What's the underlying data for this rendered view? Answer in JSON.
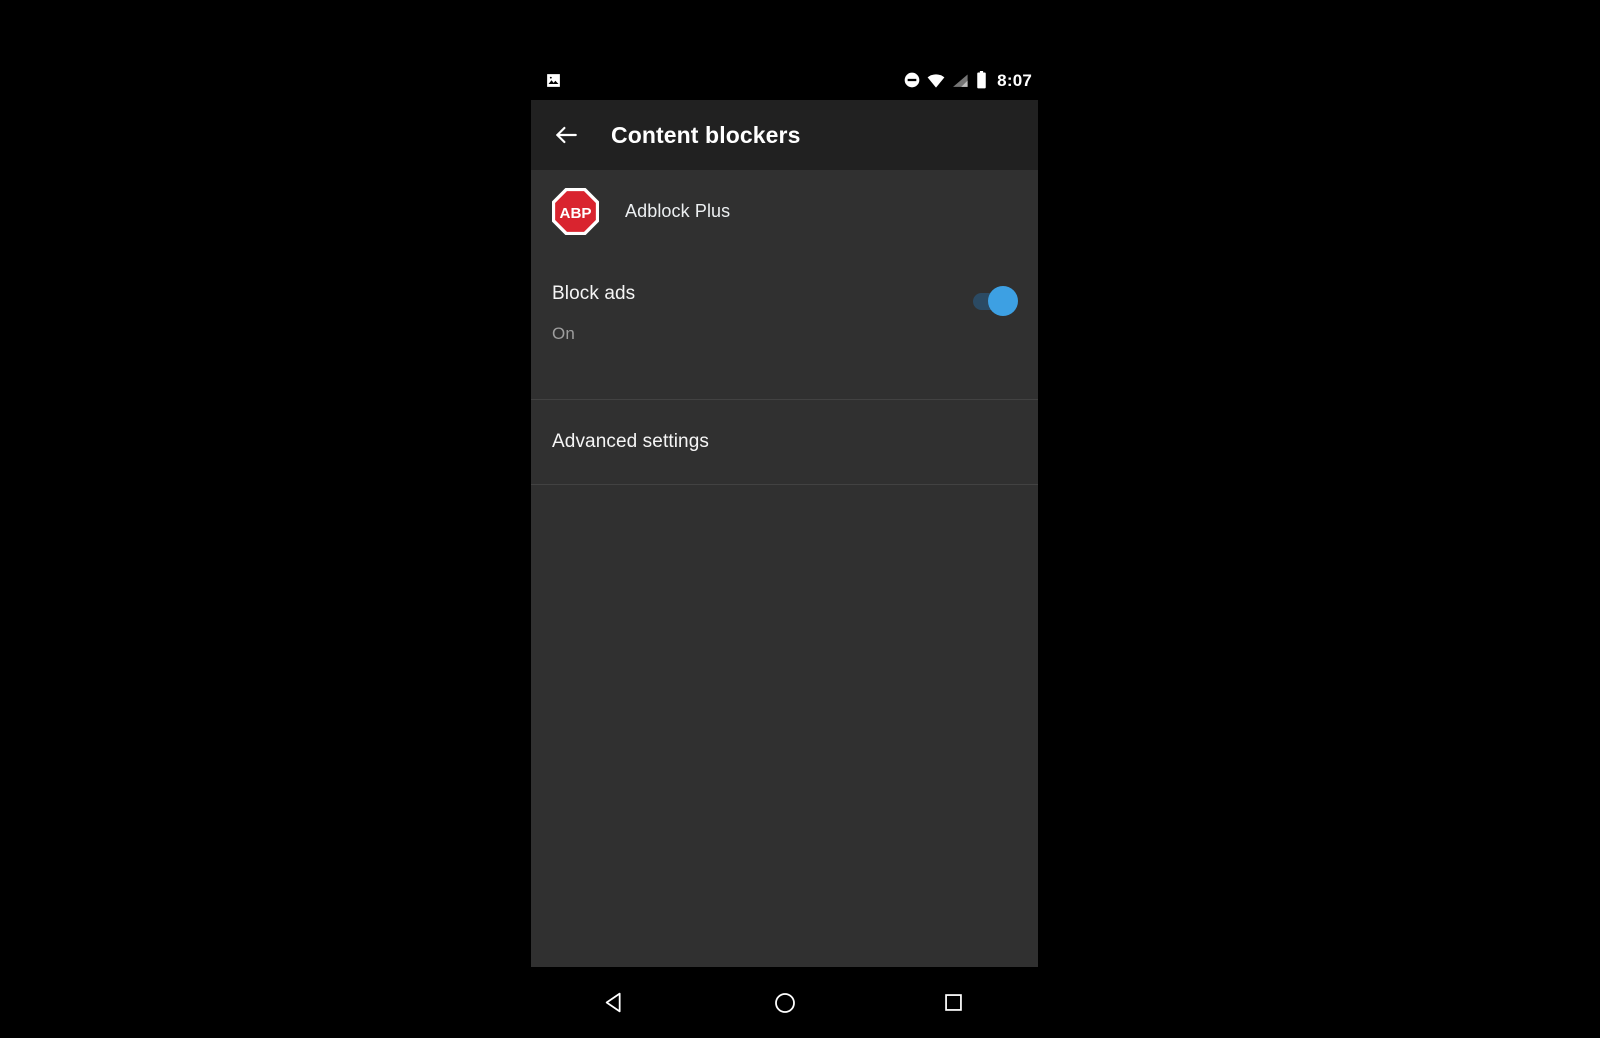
{
  "status_bar": {
    "notification_icon": "photo-icon",
    "icons": [
      "do-not-disturb-icon",
      "wifi-icon",
      "cellular-signal-icon",
      "battery-icon"
    ],
    "time": "8:07"
  },
  "app_bar": {
    "back_icon": "back-arrow-icon",
    "title": "Content blockers"
  },
  "content": {
    "blocker": {
      "logo_icon": "adblock-plus-logo-icon",
      "logo_text": "ABP",
      "name": "Adblock Plus"
    },
    "block_ads": {
      "title": "Block ads",
      "subtitle": "On",
      "toggle_state": "on"
    },
    "advanced": {
      "label": "Advanced settings"
    }
  },
  "nav_bar": {
    "back": "back-triangle-icon",
    "home": "home-circle-icon",
    "recents": "recents-square-icon"
  },
  "colors": {
    "page_background": "#000000",
    "app_bar": "#212121",
    "content_background": "#303030",
    "divider": "#424242",
    "toggle_thumb": "#3da0e3",
    "toggle_track": "#2b4a63",
    "abp_red": "#d9242f",
    "primary_text": "#f5f5f5",
    "secondary_text": "#9e9e9e"
  }
}
